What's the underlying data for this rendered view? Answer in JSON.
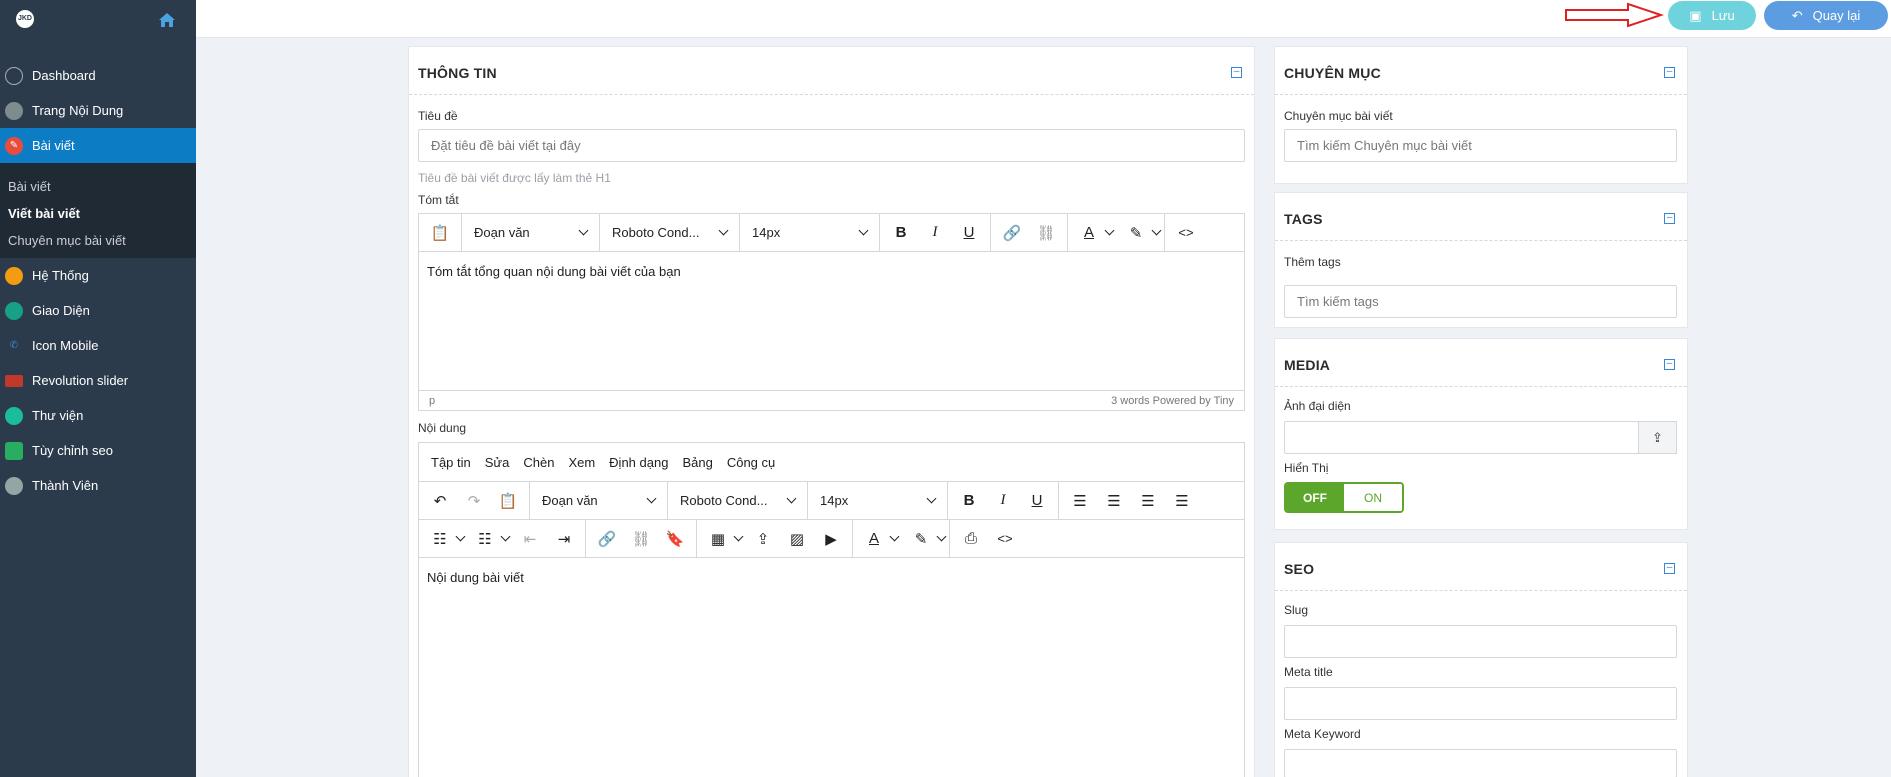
{
  "logo_text": "JKD",
  "sidebar": {
    "items": [
      {
        "label": "Dashboard",
        "icon": "speedometer-icon",
        "color": "#34495e"
      },
      {
        "label": "Trang Nội Dung",
        "icon": "page-icon",
        "color": "#7f8c8d"
      },
      {
        "label": "Bài viết",
        "icon": "pen-icon",
        "color": "#e74c3c"
      },
      {
        "label": "Hệ Thống",
        "icon": "system-icon",
        "color": "#f39c12"
      },
      {
        "label": "Giao Diện",
        "icon": "palette-icon",
        "color": "#16a085"
      },
      {
        "label": "Icon Mobile",
        "icon": "phone-icon",
        "color": "#2980b9"
      },
      {
        "label": "Revolution slider",
        "icon": "slider-icon",
        "color": "#c0392b"
      },
      {
        "label": "Thư viện",
        "icon": "image-icon",
        "color": "#1abc9c"
      },
      {
        "label": "Tùy chỉnh seo",
        "icon": "bulb-icon",
        "color": "#27ae60"
      },
      {
        "label": "Thành Viên",
        "icon": "user-icon",
        "color": "#95a5a6"
      }
    ],
    "submenu": [
      "Bài viết",
      "Viết bài viết",
      "Chuyên mục bài viết"
    ]
  },
  "topbar": {
    "save_label": "Lưu",
    "back_label": "Quay lại"
  },
  "info_panel": {
    "title": "THÔNG TIN",
    "title_label": "Tiêu đề",
    "title_placeholder": "Đặt tiêu đề bài viết tại đây",
    "title_hint": "Tiêu đề bài viết được lấy làm thẻ H1",
    "summary_label": "Tóm tắt",
    "summary_text": "Tóm tắt tổng quan nội dung bài viết của bạn",
    "summary_status_left": "p",
    "summary_status_right": "3 words  Powered by Tiny",
    "content_label": "Nội dung",
    "content_text": "Nội dung bài viết",
    "editor_menu": [
      "Tập tin",
      "Sửa",
      "Chèn",
      "Xem",
      "Định dạng",
      "Bảng",
      "Công cụ"
    ],
    "format_select": "Đoạn văn",
    "font_select": "Roboto Cond...",
    "size_select": "14px"
  },
  "category_panel": {
    "title": "CHUYÊN MỤC",
    "label": "Chuyên mục bài viết",
    "placeholder": "Tìm kiếm Chuyên mục bài viết"
  },
  "tags_panel": {
    "title": "TAGS",
    "label": "Thêm tags",
    "placeholder": "Tìm kiếm tags"
  },
  "media_panel": {
    "title": "MEDIA",
    "label": "Ảnh đại diện",
    "display_label": "Hiển Thị",
    "toggle_off": "OFF",
    "toggle_on": "ON"
  },
  "seo_panel": {
    "title": "SEO",
    "slug_label": "Slug",
    "meta_title_label": "Meta title",
    "meta_keyword_label": "Meta Keyword"
  },
  "colors": {
    "sidebar_bg": "#2c3b4c",
    "active_blue": "#0c7cc4",
    "save_btn": "#6fd3dd",
    "back_btn": "#5b9de0",
    "toggle_green": "#5ca62c"
  }
}
